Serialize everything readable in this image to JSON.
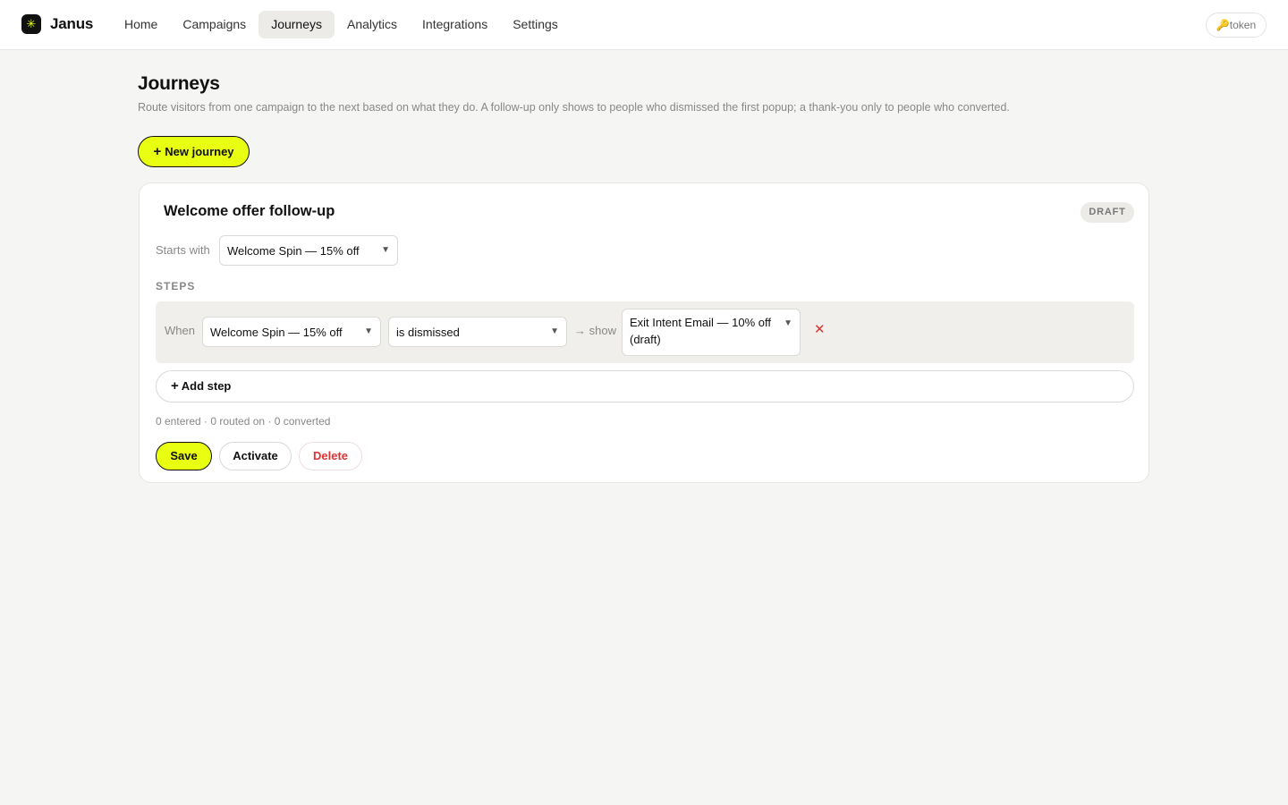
{
  "app": {
    "brand": "Janus",
    "logo_glyph": "✳"
  },
  "nav": {
    "items": [
      {
        "label": "Home"
      },
      {
        "label": "Campaigns"
      },
      {
        "label": "Journeys",
        "active": true
      },
      {
        "label": "Analytics"
      },
      {
        "label": "Integrations"
      },
      {
        "label": "Settings"
      }
    ]
  },
  "token_button": {
    "icon": "🔑",
    "label": "token"
  },
  "page": {
    "title": "Journeys",
    "description": "Route visitors from one campaign to the next based on what they do. A follow-up only shows to people who dismissed the first popup; a thank-you only to people who converted.",
    "new_journey_label": "New journey"
  },
  "journey": {
    "name": "Welcome offer follow-up",
    "status": "DRAFT",
    "starts_with_label": "Starts with",
    "starts_with_value": "Welcome Spin — 15% off",
    "steps_label": "STEPS",
    "steps": [
      {
        "when_label": "When",
        "campaign": "Welcome Spin — 15% off",
        "condition": "is dismissed",
        "show_label": "→ show",
        "target": "Exit Intent Email — 10% off (draft)",
        "remove_glyph": "✕"
      }
    ],
    "add_step_label": "Add step",
    "stats": "0 entered · 0 routed on · 0 converted",
    "actions": {
      "save": "Save",
      "activate": "Activate",
      "delete": "Delete"
    }
  },
  "colors": {
    "accent": "#e8ff12",
    "danger": "#dd3333",
    "background": "#f5f5f4"
  }
}
